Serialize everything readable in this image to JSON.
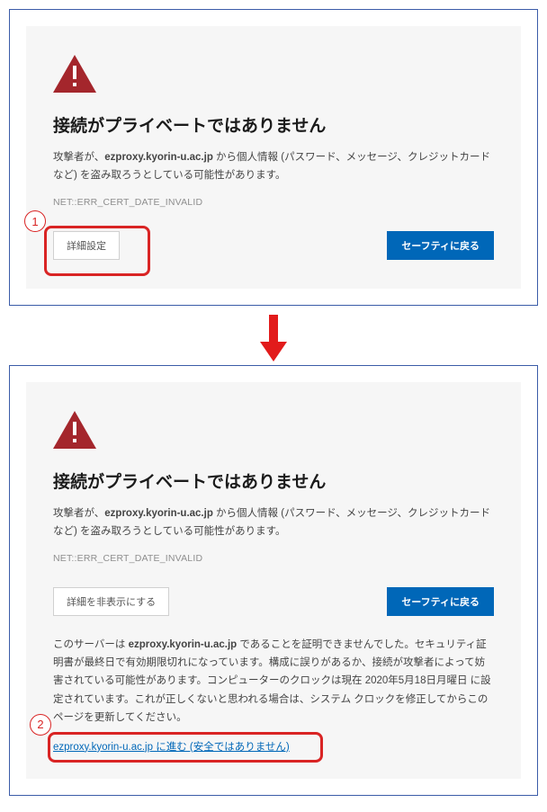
{
  "icons": {
    "warning": "warning-triangle"
  },
  "panel1": {
    "title": "接続がプライベートではありません",
    "body_prefix": "攻撃者が、",
    "host_bold": "ezproxy.kyorin-u.ac.jp",
    "body_suffix": " から個人情報 (パスワード、メッセージ、クレジットカードなど) を盗み取ろうとしている可能性があります。",
    "error_code": "NET::ERR_CERT_DATE_INVALID",
    "advanced_label": "詳細設定",
    "safety_label": "セーフティに戻る",
    "callout_num": "1"
  },
  "panel2": {
    "title": "接続がプライベートではありません",
    "body_prefix": "攻撃者が、",
    "host_bold": "ezproxy.kyorin-u.ac.jp",
    "body_suffix": " から個人情報 (パスワード、メッセージ、クレジットカードなど) を盗み取ろうとしている可能性があります。",
    "error_code": "NET::ERR_CERT_DATE_INVALID",
    "hide_details_label": "詳細を非表示にする",
    "safety_label": "セーフティに戻る",
    "detail_prefix": "このサーバーは ",
    "detail_host_bold": "ezproxy.kyorin-u.ac.jp",
    "detail_suffix": " であることを証明できませんでした。セキュリティ証明書が最終日で有効期限切れになっています。構成に誤りがあるか、接続が攻撃者によって妨害されている可能性があります。コンピューターのクロックは現在 2020年5月18日月曜日 に設定されています。これが正しくないと思われる場合は、システム クロックを修正してからこのページを更新してください。",
    "proceed_link": "ezproxy.kyorin-u.ac.jp に進む (安全ではありません)",
    "callout_num": "2"
  }
}
